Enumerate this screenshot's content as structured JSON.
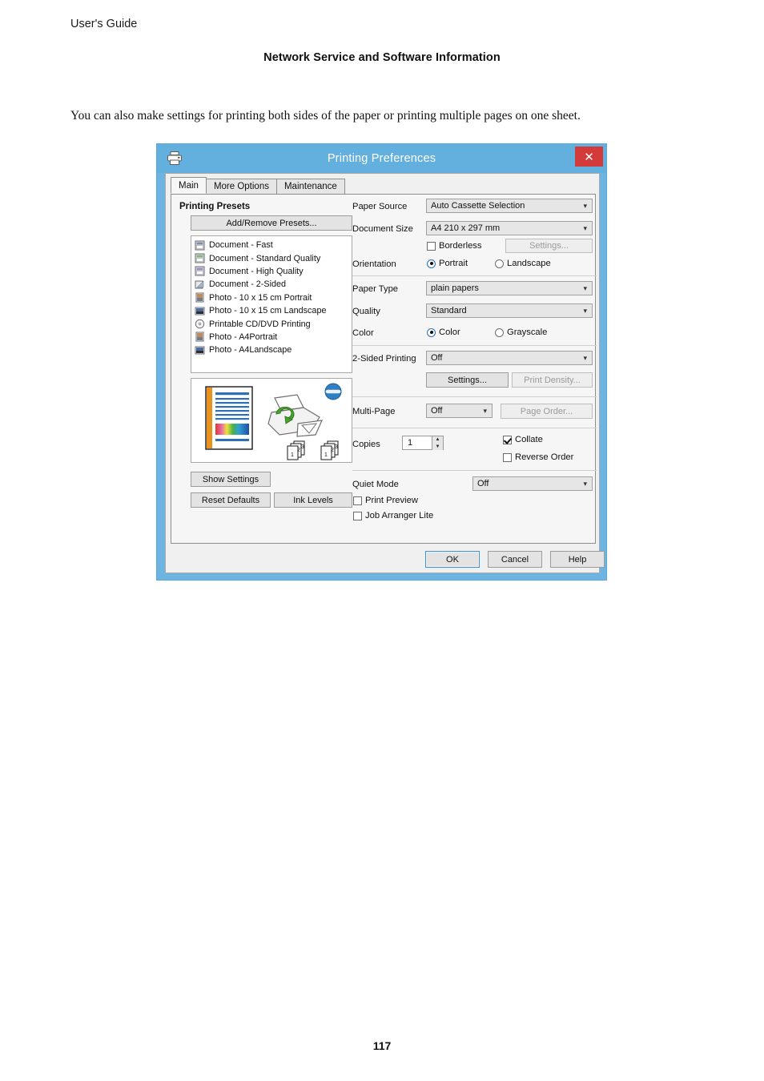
{
  "page": {
    "header": "User's Guide",
    "chapter": "Network Service and Software Information",
    "paragraph": "You can also make settings for printing both sides of the paper or printing multiple pages on one sheet.",
    "page_number": "117"
  },
  "dialog": {
    "title": "Printing Preferences",
    "titlebar_icon": "printer-icon",
    "close_label": "✕",
    "titlebar_color": "#63b0de",
    "close_color": "#d33b3b",
    "tabs": [
      {
        "label": "Main",
        "active": true
      },
      {
        "label": "More Options",
        "active": false
      },
      {
        "label": "Maintenance",
        "active": false
      }
    ],
    "left": {
      "presets_title": "Printing Presets",
      "add_remove_label": "Add/Remove Presets...",
      "presets": [
        {
          "label": "Document - Fast",
          "icon": "document-fast-icon"
        },
        {
          "label": "Document - Standard Quality",
          "icon": "document-standard-icon"
        },
        {
          "label": "Document - High Quality",
          "icon": "document-high-icon"
        },
        {
          "label": "Document - 2-Sided",
          "icon": "document-2sided-icon"
        },
        {
          "label": "Photo - 10 x 15 cm Portrait",
          "icon": "photo-portrait-icon"
        },
        {
          "label": "Photo - 10 x 15 cm Landscape",
          "icon": "photo-landscape-icon"
        },
        {
          "label": "Printable CD/DVD Printing",
          "icon": "cd-dvd-icon"
        },
        {
          "label": "Photo - A4Portrait",
          "icon": "photo-portrait-icon"
        },
        {
          "label": "Photo - A4Landscape",
          "icon": "photo-landscape-icon"
        }
      ],
      "show_settings_label": "Show Settings",
      "reset_defaults_label": "Reset Defaults",
      "ink_levels_label": "Ink Levels"
    },
    "right": {
      "paper_source": {
        "label": "Paper Source",
        "value": "Auto Cassette Selection"
      },
      "document_size": {
        "label": "Document Size",
        "value": "A4 210 x 297 mm"
      },
      "borderless": {
        "label": "Borderless",
        "checked": false
      },
      "borderless_settings": {
        "label": "Settings...",
        "disabled": true
      },
      "orientation": {
        "label": "Orientation",
        "options": [
          {
            "label": "Portrait",
            "selected": true
          },
          {
            "label": "Landscape",
            "selected": false
          }
        ]
      },
      "paper_type": {
        "label": "Paper Type",
        "value": "plain papers"
      },
      "quality": {
        "label": "Quality",
        "value": "Standard"
      },
      "color": {
        "label": "Color",
        "options": [
          {
            "label": "Color",
            "selected": true
          },
          {
            "label": "Grayscale",
            "selected": false
          }
        ]
      },
      "two_sided": {
        "label": "2-Sided Printing",
        "value": "Off"
      },
      "two_sided_settings": {
        "label": "Settings...",
        "disabled": false
      },
      "print_density": {
        "label": "Print Density...",
        "disabled": true
      },
      "multi_page": {
        "label": "Multi-Page",
        "value": "Off"
      },
      "page_order": {
        "label": "Page Order...",
        "disabled": true
      },
      "copies": {
        "label": "Copies",
        "value": "1"
      },
      "collate": {
        "label": "Collate",
        "checked": true
      },
      "reverse_order": {
        "label": "Reverse Order",
        "checked": false
      },
      "quiet_mode": {
        "label": "Quiet Mode",
        "value": "Off"
      },
      "print_preview": {
        "label": "Print Preview",
        "checked": false
      },
      "job_arranger": {
        "label": "Job Arranger Lite",
        "checked": false
      }
    },
    "footer": {
      "ok_label": "OK",
      "cancel_label": "Cancel",
      "help_label": "Help"
    }
  }
}
